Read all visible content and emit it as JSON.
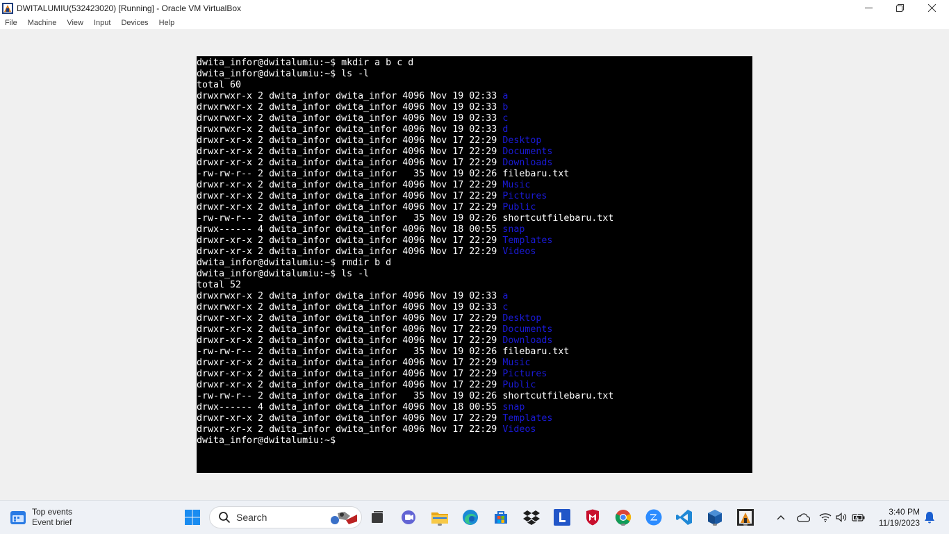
{
  "window": {
    "title": "DWITALUMIU(532423020) [Running] - Oracle VM VirtualBox"
  },
  "menu": [
    "File",
    "Machine",
    "View",
    "Input",
    "Devices",
    "Help"
  ],
  "terminal": {
    "lines": [
      {
        "t": "dwita_infor@dwitalumiu:~$ mkdir a b c d"
      },
      {
        "t": "dwita_infor@dwitalumiu:~$ ls -l"
      },
      {
        "t": "total 60"
      },
      {
        "t": "drwxrwxr-x 2 dwita_infor dwita_infor 4096 Nov 19 02:33 ",
        "n": "a",
        "dir": true
      },
      {
        "t": "drwxrwxr-x 2 dwita_infor dwita_infor 4096 Nov 19 02:33 ",
        "n": "b",
        "dir": true
      },
      {
        "t": "drwxrwxr-x 2 dwita_infor dwita_infor 4096 Nov 19 02:33 ",
        "n": "c",
        "dir": true
      },
      {
        "t": "drwxrwxr-x 2 dwita_infor dwita_infor 4096 Nov 19 02:33 ",
        "n": "d",
        "dir": true
      },
      {
        "t": "drwxr-xr-x 2 dwita_infor dwita_infor 4096 Nov 17 22:29 ",
        "n": "Desktop",
        "dir": true
      },
      {
        "t": "drwxr-xr-x 2 dwita_infor dwita_infor 4096 Nov 17 22:29 ",
        "n": "Documents",
        "dir": true
      },
      {
        "t": "drwxr-xr-x 2 dwita_infor dwita_infor 4096 Nov 17 22:29 ",
        "n": "Downloads",
        "dir": true
      },
      {
        "t": "-rw-rw-r-- 2 dwita_infor dwita_infor   35 Nov 19 02:26 ",
        "n": "filebaru.txt",
        "dir": false
      },
      {
        "t": "drwxr-xr-x 2 dwita_infor dwita_infor 4096 Nov 17 22:29 ",
        "n": "Music",
        "dir": true
      },
      {
        "t": "drwxr-xr-x 2 dwita_infor dwita_infor 4096 Nov 17 22:29 ",
        "n": "Pictures",
        "dir": true
      },
      {
        "t": "drwxr-xr-x 2 dwita_infor dwita_infor 4096 Nov 17 22:29 ",
        "n": "Public",
        "dir": true
      },
      {
        "t": "-rw-rw-r-- 2 dwita_infor dwita_infor   35 Nov 19 02:26 ",
        "n": "shortcutfilebaru.txt",
        "dir": false
      },
      {
        "t": "drwx------ 4 dwita_infor dwita_infor 4096 Nov 18 00:55 ",
        "n": "snap",
        "dir": true
      },
      {
        "t": "drwxr-xr-x 2 dwita_infor dwita_infor 4096 Nov 17 22:29 ",
        "n": "Templates",
        "dir": true
      },
      {
        "t": "drwxr-xr-x 2 dwita_infor dwita_infor 4096 Nov 17 22:29 ",
        "n": "Videos",
        "dir": true
      },
      {
        "t": "dwita_infor@dwitalumiu:~$ rmdir b d"
      },
      {
        "t": "dwita_infor@dwitalumiu:~$ ls -l"
      },
      {
        "t": "total 52"
      },
      {
        "t": "drwxrwxr-x 2 dwita_infor dwita_infor 4096 Nov 19 02:33 ",
        "n": "a",
        "dir": true
      },
      {
        "t": "drwxrwxr-x 2 dwita_infor dwita_infor 4096 Nov 19 02:33 ",
        "n": "c",
        "dir": true
      },
      {
        "t": "drwxr-xr-x 2 dwita_infor dwita_infor 4096 Nov 17 22:29 ",
        "n": "Desktop",
        "dir": true
      },
      {
        "t": "drwxr-xr-x 2 dwita_infor dwita_infor 4096 Nov 17 22:29 ",
        "n": "Documents",
        "dir": true
      },
      {
        "t": "drwxr-xr-x 2 dwita_infor dwita_infor 4096 Nov 17 22:29 ",
        "n": "Downloads",
        "dir": true
      },
      {
        "t": "-rw-rw-r-- 2 dwita_infor dwita_infor   35 Nov 19 02:26 ",
        "n": "filebaru.txt",
        "dir": false
      },
      {
        "t": "drwxr-xr-x 2 dwita_infor dwita_infor 4096 Nov 17 22:29 ",
        "n": "Music",
        "dir": true
      },
      {
        "t": "drwxr-xr-x 2 dwita_infor dwita_infor 4096 Nov 17 22:29 ",
        "n": "Pictures",
        "dir": true
      },
      {
        "t": "drwxr-xr-x 2 dwita_infor dwita_infor 4096 Nov 17 22:29 ",
        "n": "Public",
        "dir": true
      },
      {
        "t": "-rw-rw-r-- 2 dwita_infor dwita_infor   35 Nov 19 02:26 ",
        "n": "shortcutfilebaru.txt",
        "dir": false
      },
      {
        "t": "drwx------ 4 dwita_infor dwita_infor 4096 Nov 18 00:55 ",
        "n": "snap",
        "dir": true
      },
      {
        "t": "drwxr-xr-x 2 dwita_infor dwita_infor 4096 Nov 17 22:29 ",
        "n": "Templates",
        "dir": true
      },
      {
        "t": "drwxr-xr-x 2 dwita_infor dwita_infor 4096 Nov 17 22:29 ",
        "n": "Videos",
        "dir": true
      },
      {
        "t": "dwita_infor@dwitalumiu:~$ "
      }
    ],
    "dir_color": "#1a1ad6",
    "text_color": "#ffffff",
    "background": "#000000"
  },
  "taskbar": {
    "widget": {
      "title": "Top events",
      "subtitle": "Event brief"
    },
    "search": {
      "label": "Search"
    },
    "apps": [
      {
        "name": "task-view-icon"
      },
      {
        "name": "teams-chat-icon"
      },
      {
        "name": "file-explorer-icon"
      },
      {
        "name": "edge-icon"
      },
      {
        "name": "microsoft-store-icon"
      },
      {
        "name": "dropbox-icon"
      },
      {
        "name": "lenovo-l-icon"
      },
      {
        "name": "mcafee-icon"
      },
      {
        "name": "chrome-icon"
      },
      {
        "name": "zoom-icon"
      },
      {
        "name": "vscode-icon"
      },
      {
        "name": "virtualbox-icon"
      },
      {
        "name": "virtualbox-vm-icon"
      }
    ],
    "clock": {
      "time": "3:40 PM",
      "date": "11/19/2023"
    }
  }
}
